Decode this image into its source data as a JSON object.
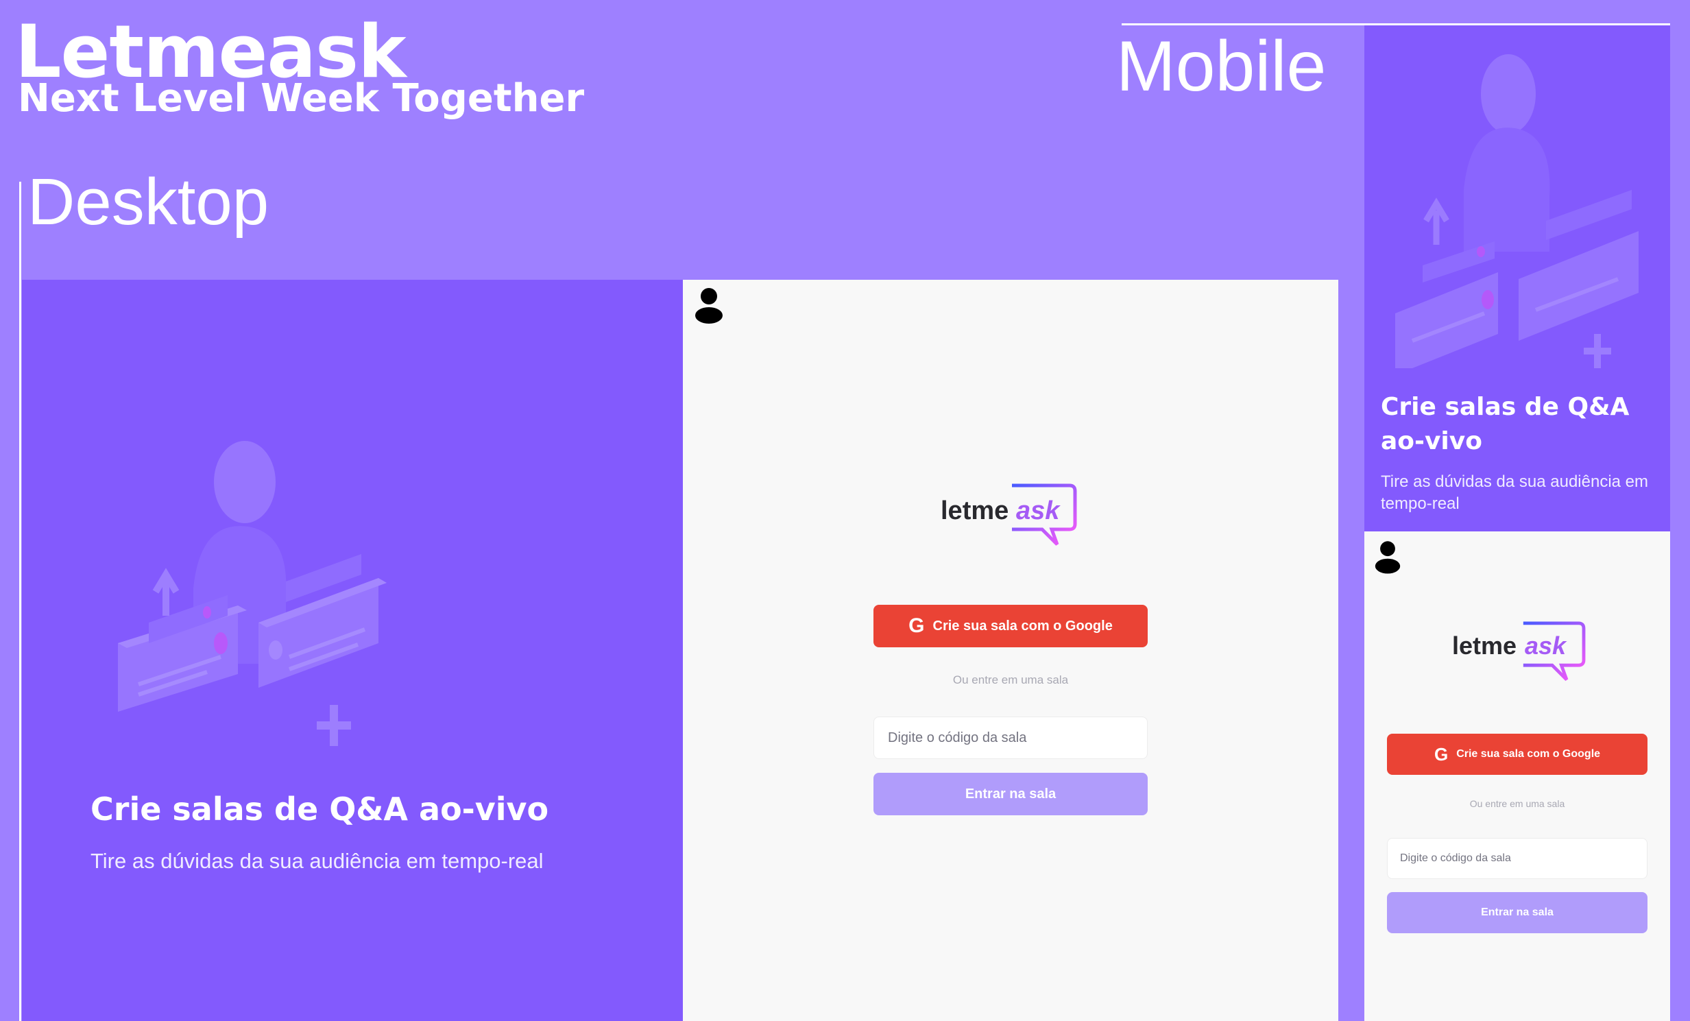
{
  "header": {
    "app_title": "Letmeask",
    "app_subtitle": "Next Level Week Together",
    "desktop_label": "Desktop",
    "mobile_label": "Mobile"
  },
  "colors": {
    "background": "#9e80ff",
    "panel_purple": "#835afd",
    "panel_light": "#f8f8f8",
    "google_red": "#ea4335",
    "enter_button": "#b09cfb"
  },
  "desktop": {
    "aside": {
      "heading": "Crie salas de Q&A ao-vivo",
      "description": "Tire as dúvidas da sua audiência em tempo-real"
    },
    "main": {
      "logo_part1": "letme",
      "logo_part2": "ask",
      "google_icon": "G",
      "google_button": "Crie sua sala com o Google",
      "separator": "Ou entre em uma sala",
      "room_input_placeholder": "Digite o código da sala",
      "enter_button": "Entrar na sala"
    }
  },
  "mobile": {
    "aside": {
      "heading": "Crie salas de Q&A ao-vivo",
      "description": "Tire as dúvidas da sua audiência em tempo-real"
    },
    "main": {
      "logo_part1": "letme",
      "logo_part2": "ask",
      "google_icon": "G",
      "google_button": "Crie sua sala com o Google",
      "separator": "Ou entre em uma sala",
      "room_input_placeholder": "Digite o código da sala",
      "enter_button": "Entrar na sala"
    }
  }
}
